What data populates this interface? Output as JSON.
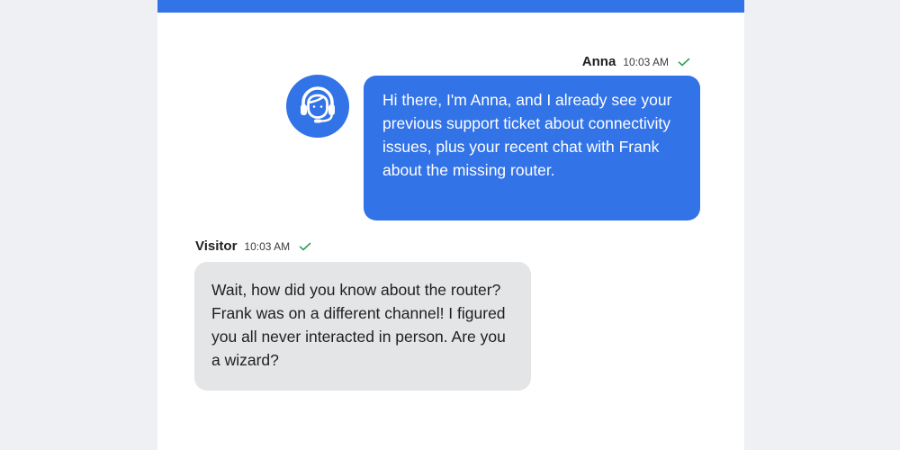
{
  "icons": {
    "agent_avatar": "headset-agent-icon",
    "read_receipt": "check-icon"
  },
  "colors": {
    "accent": "#3273e8",
    "agent_bubble": "#3273e8",
    "visitor_bubble": "#e4e5e7",
    "check": "#2e9e5b"
  },
  "messages": [
    {
      "sender": "Anna",
      "time": "10:03 AM",
      "text": "Hi there, I'm Anna, and I already see your previous support ticket about connectivity issues, plus your recent chat with Frank about the missing router."
    },
    {
      "sender": "Visitor",
      "time": "10:03 AM",
      "text": "Wait, how did you know about the router? Frank was on a different channel! I figured you all never interacted in person. Are you a wizard?"
    }
  ]
}
